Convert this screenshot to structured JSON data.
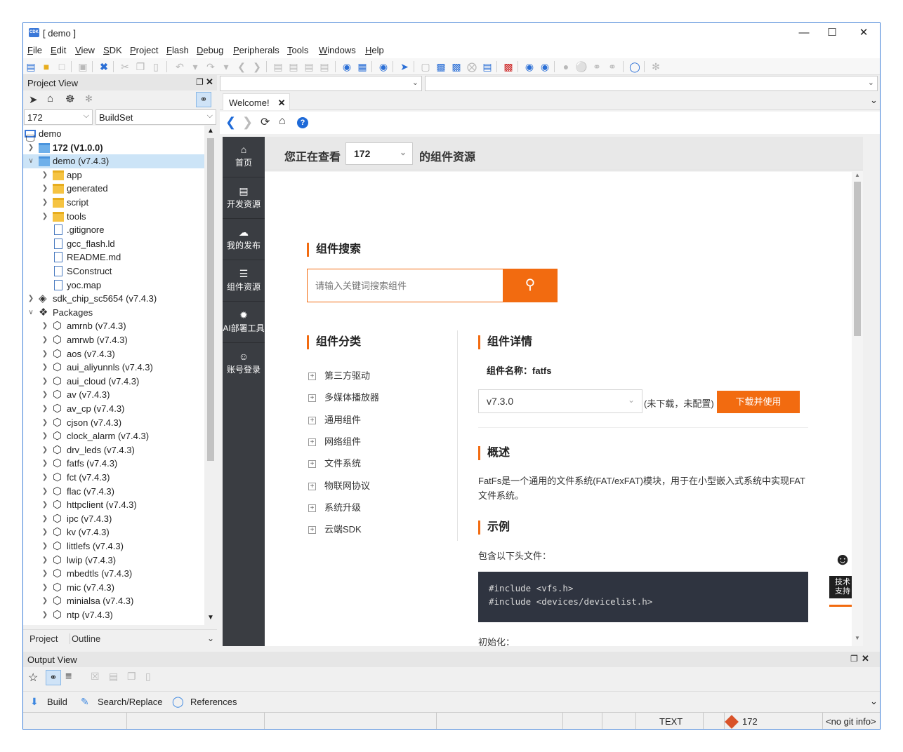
{
  "window": {
    "title": "[ demo ]",
    "app_icon_text": "CDK"
  },
  "menu": [
    "File",
    "Edit",
    "View",
    "SDK",
    "Project",
    "Flash",
    "Debug",
    "Peripherals",
    "Tools",
    "Windows",
    "Help"
  ],
  "project_view": {
    "title": "Project View",
    "chip_select": "172",
    "buildset_select": "BuildSet",
    "tree": [
      {
        "label": "demo",
        "level": 0,
        "type": "monitor",
        "expander": ""
      },
      {
        "label": "172 (V1.0.0)",
        "level": 1,
        "type": "folder-blue",
        "expander": ">",
        "bold": true
      },
      {
        "label": "demo (v7.4.3)",
        "level": 1,
        "type": "folder-blue",
        "expander": "v",
        "selected": true
      },
      {
        "label": "app",
        "level": 2,
        "type": "folder",
        "expander": ">"
      },
      {
        "label": "generated",
        "level": 2,
        "type": "folder",
        "expander": ">"
      },
      {
        "label": "script",
        "level": 2,
        "type": "folder",
        "expander": ">"
      },
      {
        "label": "tools",
        "level": 2,
        "type": "folder",
        "expander": ">"
      },
      {
        "label": ".gitignore",
        "level": 2,
        "type": "file",
        "expander": ""
      },
      {
        "label": "gcc_flash.ld",
        "level": 2,
        "type": "file",
        "expander": ""
      },
      {
        "label": "README.md",
        "level": 2,
        "type": "file",
        "expander": ""
      },
      {
        "label": "SConstruct",
        "level": 2,
        "type": "file",
        "expander": ""
      },
      {
        "label": "yoc.map",
        "level": 2,
        "type": "file",
        "expander": ""
      },
      {
        "label": "sdk_chip_sc5654 (v7.4.3)",
        "level": 1,
        "type": "chip",
        "expander": ">"
      },
      {
        "label": "Packages",
        "level": 1,
        "type": "packages",
        "expander": "v"
      },
      {
        "label": "amrnb (v7.4.3)",
        "level": 2,
        "type": "pkg",
        "expander": ">"
      },
      {
        "label": "amrwb (v7.4.3)",
        "level": 2,
        "type": "pkg",
        "expander": ">"
      },
      {
        "label": "aos (v7.4.3)",
        "level": 2,
        "type": "pkg",
        "expander": ">"
      },
      {
        "label": "aui_aliyunnls (v7.4.3)",
        "level": 2,
        "type": "pkg",
        "expander": ">"
      },
      {
        "label": "aui_cloud (v7.4.3)",
        "level": 2,
        "type": "pkg",
        "expander": ">"
      },
      {
        "label": "av (v7.4.3)",
        "level": 2,
        "type": "pkg",
        "expander": ">"
      },
      {
        "label": "av_cp (v7.4.3)",
        "level": 2,
        "type": "pkg",
        "expander": ">"
      },
      {
        "label": "cjson (v7.4.3)",
        "level": 2,
        "type": "pkg",
        "expander": ">"
      },
      {
        "label": "clock_alarm (v7.4.3)",
        "level": 2,
        "type": "pkg",
        "expander": ">"
      },
      {
        "label": "drv_leds (v7.4.3)",
        "level": 2,
        "type": "pkg",
        "expander": ">"
      },
      {
        "label": "fatfs (v7.4.3)",
        "level": 2,
        "type": "pkg",
        "expander": ">"
      },
      {
        "label": "fct (v7.4.3)",
        "level": 2,
        "type": "pkg",
        "expander": ">"
      },
      {
        "label": "flac (v7.4.3)",
        "level": 2,
        "type": "pkg",
        "expander": ">"
      },
      {
        "label": "httpclient (v7.4.3)",
        "level": 2,
        "type": "pkg",
        "expander": ">"
      },
      {
        "label": "ipc (v7.4.3)",
        "level": 2,
        "type": "pkg",
        "expander": ">"
      },
      {
        "label": "kv (v7.4.3)",
        "level": 2,
        "type": "pkg",
        "expander": ">"
      },
      {
        "label": "littlefs (v7.4.3)",
        "level": 2,
        "type": "pkg",
        "expander": ">"
      },
      {
        "label": "lwip (v7.4.3)",
        "level": 2,
        "type": "pkg",
        "expander": ">"
      },
      {
        "label": "mbedtls (v7.4.3)",
        "level": 2,
        "type": "pkg",
        "expander": ">"
      },
      {
        "label": "mic (v7.4.3)",
        "level": 2,
        "type": "pkg",
        "expander": ">"
      },
      {
        "label": "minialsa (v7.4.3)",
        "level": 2,
        "type": "pkg",
        "expander": ">"
      },
      {
        "label": "ntp (v7.4.3)",
        "level": 2,
        "type": "pkg",
        "expander": ">"
      }
    ],
    "bottom_tabs": [
      "Project",
      "Outline"
    ]
  },
  "editor": {
    "tab_label": "Welcome!"
  },
  "web": {
    "sidebar": [
      {
        "label": "首页",
        "icon": "home-icon"
      },
      {
        "label": "开发资源",
        "icon": "code-folder-icon"
      },
      {
        "label": "我的发布",
        "icon": "cloud-upload-icon"
      },
      {
        "label": "组件资源",
        "icon": "component-list-icon"
      },
      {
        "label": "AI部署工具",
        "icon": "ai-icon"
      },
      {
        "label": "账号登录",
        "icon": "user-icon"
      }
    ],
    "header": {
      "prefix": "您正在查看",
      "chip": "172",
      "suffix": "的组件资源"
    },
    "search": {
      "title": "组件搜索",
      "placeholder": "请输入关键词搜索组件"
    },
    "categories": {
      "title": "组件分类",
      "items": [
        "第三方驱动",
        "多媒体播放器",
        "通用组件",
        "网络组件",
        "文件系统",
        "物联网协议",
        "系统升级",
        "云端SDK"
      ]
    },
    "detail": {
      "title": "组件详情",
      "name_label": "组件名称：",
      "name_value": "fatfs",
      "version": "v7.3.0",
      "status": "(未下载，未配置)",
      "download_button": "下载并使用",
      "overview_title": "概述",
      "overview_text": "FatFs是一个通用的文件系统(FAT/exFAT)模块，用于在小型嵌入式系统中实现FAT文件系统。",
      "example_title": "示例",
      "header_files_label": "包含以下头文件：",
      "code_lines": [
        "#include <vfs.h>",
        "#include <devices/devicelist.h>"
      ],
      "init_label": "初始化："
    },
    "support": {
      "line1": "技术",
      "line2": "支持"
    }
  },
  "output_view": {
    "title": "Output View",
    "tabs": [
      "Build",
      "Search/Replace",
      "References"
    ]
  },
  "status_bar": {
    "mode": "TEXT",
    "chip": "172",
    "git": "<no git info>"
  },
  "colors": {
    "accent": "#f26b10",
    "sidebar_bg": "#3a3d42",
    "selection": "#cce4f7",
    "link_blue": "#1e6ad8"
  }
}
